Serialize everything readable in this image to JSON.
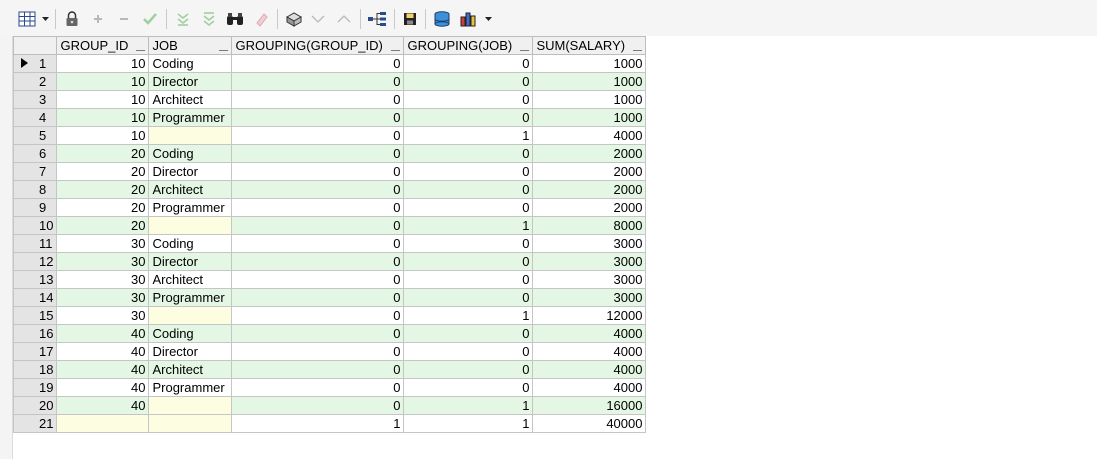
{
  "toolbar": {
    "icons": [
      "grid-view-icon",
      "dropdown-arrow-icon",
      "lock-icon",
      "add-record-icon",
      "delete-record-icon",
      "post-edit-icon",
      "filter-down-icon",
      "filter-up-icon",
      "find-binoculars-icon",
      "clear-eraser-icon",
      "query-by-example-icon",
      "sort-down-icon",
      "sort-up-icon",
      "tree-icon",
      "save-icon",
      "export-database-icon",
      "chart-icon",
      "dropdown-arrow-icon"
    ]
  },
  "columns": [
    "GROUP_ID",
    "JOB",
    "GROUPING(GROUP_ID)",
    "GROUPING(JOB)",
    "SUM(SALARY)"
  ],
  "rows": [
    {
      "n": "1",
      "group_id": "10",
      "job": "Coding",
      "g_gid": "0",
      "g_job": "0",
      "sum": "1000"
    },
    {
      "n": "2",
      "group_id": "10",
      "job": "Director",
      "g_gid": "0",
      "g_job": "0",
      "sum": "1000"
    },
    {
      "n": "3",
      "group_id": "10",
      "job": "Architect",
      "g_gid": "0",
      "g_job": "0",
      "sum": "1000"
    },
    {
      "n": "4",
      "group_id": "10",
      "job": "Programmer",
      "g_gid": "0",
      "g_job": "0",
      "sum": "1000"
    },
    {
      "n": "5",
      "group_id": "10",
      "job": "",
      "g_gid": "0",
      "g_job": "1",
      "sum": "4000"
    },
    {
      "n": "6",
      "group_id": "20",
      "job": "Coding",
      "g_gid": "0",
      "g_job": "0",
      "sum": "2000"
    },
    {
      "n": "7",
      "group_id": "20",
      "job": "Director",
      "g_gid": "0",
      "g_job": "0",
      "sum": "2000"
    },
    {
      "n": "8",
      "group_id": "20",
      "job": "Architect",
      "g_gid": "0",
      "g_job": "0",
      "sum": "2000"
    },
    {
      "n": "9",
      "group_id": "20",
      "job": "Programmer",
      "g_gid": "0",
      "g_job": "0",
      "sum": "2000"
    },
    {
      "n": "10",
      "group_id": "20",
      "job": "",
      "g_gid": "0",
      "g_job": "1",
      "sum": "8000"
    },
    {
      "n": "11",
      "group_id": "30",
      "job": "Coding",
      "g_gid": "0",
      "g_job": "0",
      "sum": "3000"
    },
    {
      "n": "12",
      "group_id": "30",
      "job": "Director",
      "g_gid": "0",
      "g_job": "0",
      "sum": "3000"
    },
    {
      "n": "13",
      "group_id": "30",
      "job": "Architect",
      "g_gid": "0",
      "g_job": "0",
      "sum": "3000"
    },
    {
      "n": "14",
      "group_id": "30",
      "job": "Programmer",
      "g_gid": "0",
      "g_job": "0",
      "sum": "3000"
    },
    {
      "n": "15",
      "group_id": "30",
      "job": "",
      "g_gid": "0",
      "g_job": "1",
      "sum": "12000"
    },
    {
      "n": "16",
      "group_id": "40",
      "job": "Coding",
      "g_gid": "0",
      "g_job": "0",
      "sum": "4000"
    },
    {
      "n": "17",
      "group_id": "40",
      "job": "Director",
      "g_gid": "0",
      "g_job": "0",
      "sum": "4000"
    },
    {
      "n": "18",
      "group_id": "40",
      "job": "Architect",
      "g_gid": "0",
      "g_job": "0",
      "sum": "4000"
    },
    {
      "n": "19",
      "group_id": "40",
      "job": "Programmer",
      "g_gid": "0",
      "g_job": "0",
      "sum": "4000"
    },
    {
      "n": "20",
      "group_id": "40",
      "job": "",
      "g_gid": "0",
      "g_job": "1",
      "sum": "16000"
    },
    {
      "n": "21",
      "group_id": "",
      "job": "",
      "g_gid": "1",
      "g_job": "1",
      "sum": "40000"
    }
  ],
  "current_row": "1",
  "colors": {
    "row_alt": "#e4f7e4",
    "null_cell": "#fdfde2",
    "header": "#f0f0f0"
  }
}
